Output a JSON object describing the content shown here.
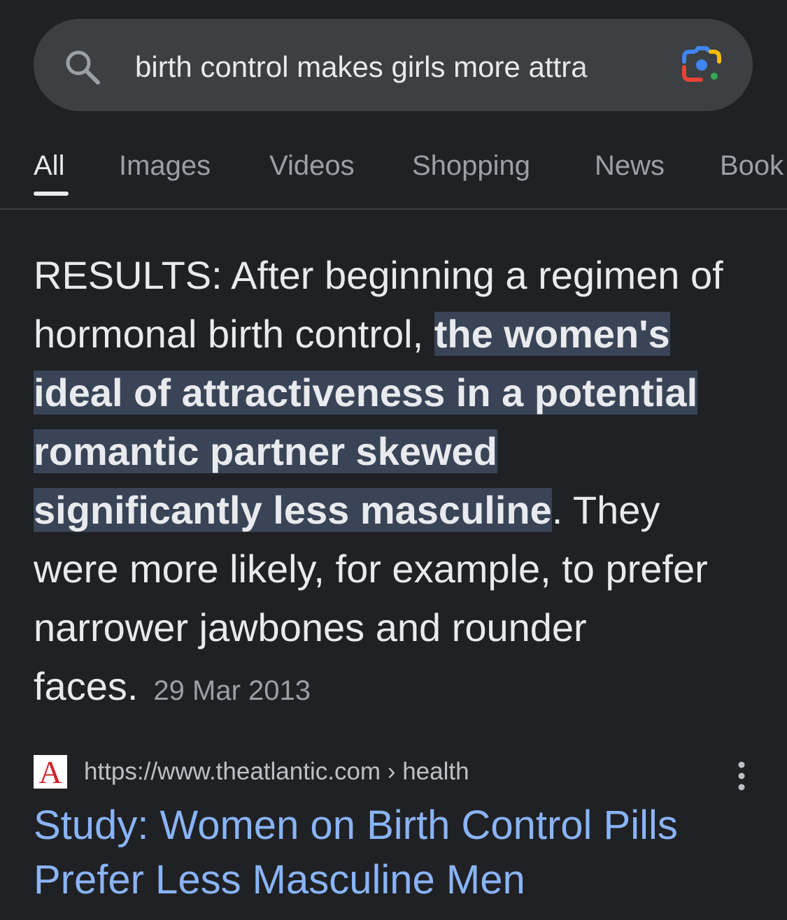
{
  "search": {
    "query": "birth control makes girls more attra"
  },
  "tabs": [
    {
      "label": "All",
      "active": true
    },
    {
      "label": "Images",
      "active": false
    },
    {
      "label": "Videos",
      "active": false
    },
    {
      "label": "Shopping",
      "active": false
    },
    {
      "label": "News",
      "active": false
    },
    {
      "label": "Book",
      "active": false
    }
  ],
  "snippet": {
    "before": "RESULTS: After beginning a regimen of hormonal birth control, ",
    "highlight": "the women's ideal of attractiveness in a potential romantic partner skewed significantly less masculine",
    "after": ". They were more likely, for example, to prefer narrower jawbones and rounder faces.",
    "date": "29 Mar 2013"
  },
  "result": {
    "favicon_letter": "A",
    "url_base": "https://www.theatlantic.com",
    "url_separator": " › ",
    "url_path": "health",
    "title": "Study: Women on Birth Control Pills Prefer Less Masculine Men"
  },
  "icons": {
    "search": "search-icon",
    "lens": "google-lens-icon",
    "more": "more-vert-icon"
  },
  "colors": {
    "background": "#202124",
    "search_bar": "#3c4043",
    "highlight": "#394457",
    "link": "#8ab4f8",
    "muted": "#9aa0a6",
    "favicon_red": "#d2232a"
  }
}
